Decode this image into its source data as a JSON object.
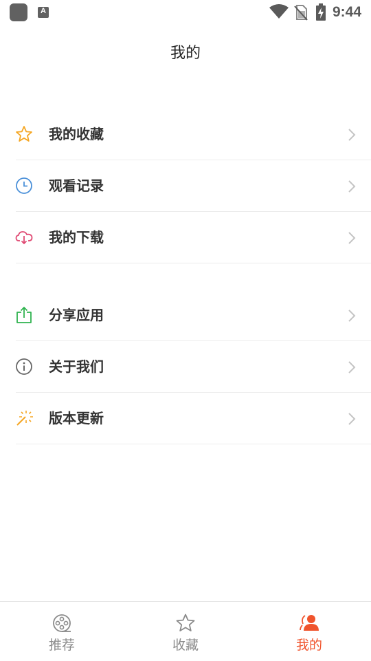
{
  "status_bar": {
    "a_icon_letter": "A",
    "time": "9:44"
  },
  "header": {
    "title": "我的"
  },
  "menu_groups": [
    {
      "items": [
        {
          "label": "我的收藏",
          "icon": "star-icon",
          "icon_color": "#f5a623"
        },
        {
          "label": "观看记录",
          "icon": "clock-icon",
          "icon_color": "#4a90d9"
        },
        {
          "label": "我的下载",
          "icon": "cloud-download-icon",
          "icon_color": "#e04a73"
        }
      ]
    },
    {
      "items": [
        {
          "label": "分享应用",
          "icon": "share-icon",
          "icon_color": "#2fb34f"
        },
        {
          "label": "关于我们",
          "icon": "info-icon",
          "icon_color": "#666666"
        },
        {
          "label": "版本更新",
          "icon": "magic-wand-icon",
          "icon_color": "#f5a623"
        }
      ]
    }
  ],
  "bottom_nav": {
    "items": [
      {
        "label": "推荐",
        "icon": "film-reel-icon",
        "active": false
      },
      {
        "label": "收藏",
        "icon": "star-outline-icon",
        "active": false
      },
      {
        "label": "我的",
        "icon": "user-icon",
        "active": true
      }
    ],
    "active_color": "#f0542d",
    "inactive_color": "#8a8a8a"
  }
}
